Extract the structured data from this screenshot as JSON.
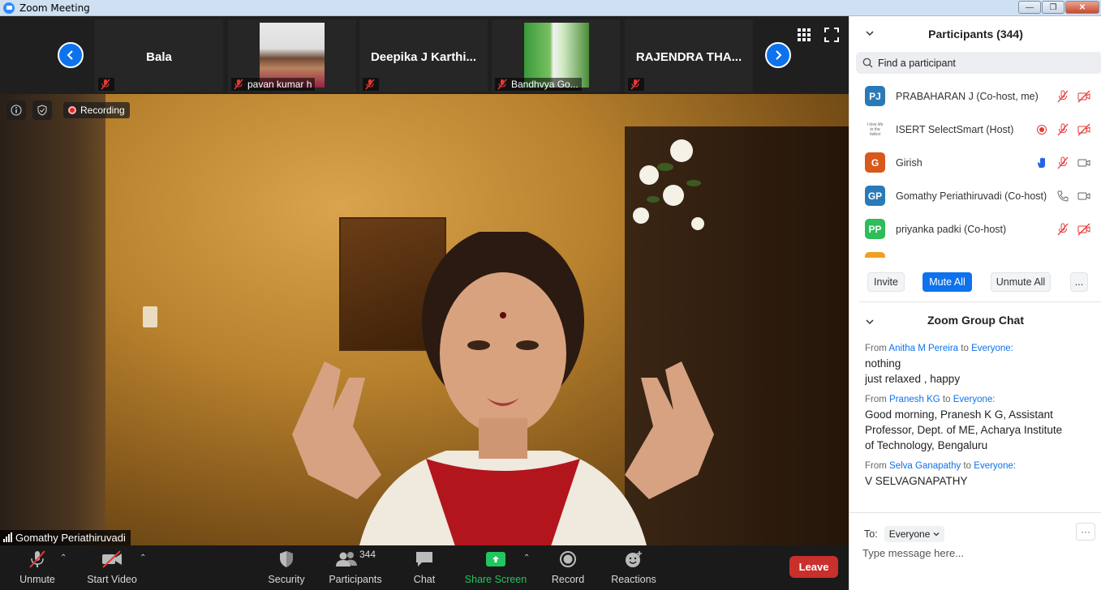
{
  "window": {
    "title": "Zoom Meeting",
    "btn_min": "—",
    "btn_max": "❐",
    "btn_close": "✕"
  },
  "strip": {
    "tiles": [
      {
        "name": "Bala",
        "label": "",
        "has_photo": false
      },
      {
        "name": "",
        "label": "pavan kumar h",
        "has_photo": true
      },
      {
        "name": "Deepika J  Karthi...",
        "label": "",
        "has_photo": false
      },
      {
        "name": "",
        "label": "Bandhvya Go...",
        "has_photo": true
      },
      {
        "name": "RAJENDRA THA...",
        "label": "",
        "has_photo": false
      }
    ]
  },
  "video": {
    "recording_label": "Recording",
    "speaker_name": "Gomathy Periathiruvadi"
  },
  "toolbar": {
    "unmute": "Unmute",
    "start_video": "Start Video",
    "security": "Security",
    "participants": "Participants",
    "participants_count": "344",
    "chat": "Chat",
    "share_screen": "Share Screen",
    "record": "Record",
    "reactions": "Reactions",
    "leave": "Leave"
  },
  "participants_panel": {
    "title": "Participants (344)",
    "search_placeholder": "Find a participant",
    "list": [
      {
        "initials": "PJ",
        "name": "PRABAHARAN J (Co-host, me)",
        "avatar_color": "#2a7ab8",
        "icons": [
          "mic-off",
          "video-off"
        ]
      },
      {
        "initials": "",
        "name": "ISERT SelectSmart (Host)",
        "avatar_color": "#ffffff",
        "avatar_logo": "I love life to the fullest",
        "icons": [
          "recording",
          "mic-off",
          "video-off"
        ]
      },
      {
        "initials": "G",
        "name": "Girish",
        "avatar_color": "#d9581c",
        "icons": [
          "raised-hand",
          "mic-off",
          "video-on"
        ]
      },
      {
        "initials": "GP",
        "name": "Gomathy Periathiruvadi (Co-host)",
        "avatar_color": "#2a7ab8",
        "icons": [
          "phone",
          "video-on"
        ]
      },
      {
        "initials": "PP",
        "name": "priyanka padki (Co-host)",
        "avatar_color": "#2ebd59",
        "icons": [
          "mic-off",
          "video-off"
        ]
      }
    ],
    "buttons": {
      "invite": "Invite",
      "mute_all": "Mute All",
      "unmute_all": "Unmute All",
      "more": "..."
    }
  },
  "chat_panel": {
    "title": "Zoom Group Chat",
    "messages": [
      {
        "from": "Anitha M Pereira",
        "to": "Everyone",
        "lines": [
          "nothing",
          "just relaxed , happy"
        ]
      },
      {
        "from": "Pranesh KG",
        "to": "Everyone",
        "lines": [
          "Good morning, Pranesh K G, Assistant",
          "Professor, Dept. of ME, Acharya Institute",
          "of Technology, Bengaluru"
        ]
      },
      {
        "from": "Selva Ganapathy",
        "to": "Everyone",
        "lines": [
          "V SELVAGNAPATHY"
        ]
      }
    ],
    "from_word": "From",
    "to_word": "to",
    "to_label": "To:",
    "to_value": "Everyone",
    "more": "···",
    "input_placeholder": "Type message here..."
  },
  "colors": {
    "accent": "#0e72ed",
    "danger": "#c9302c",
    "share": "#22c55e"
  }
}
